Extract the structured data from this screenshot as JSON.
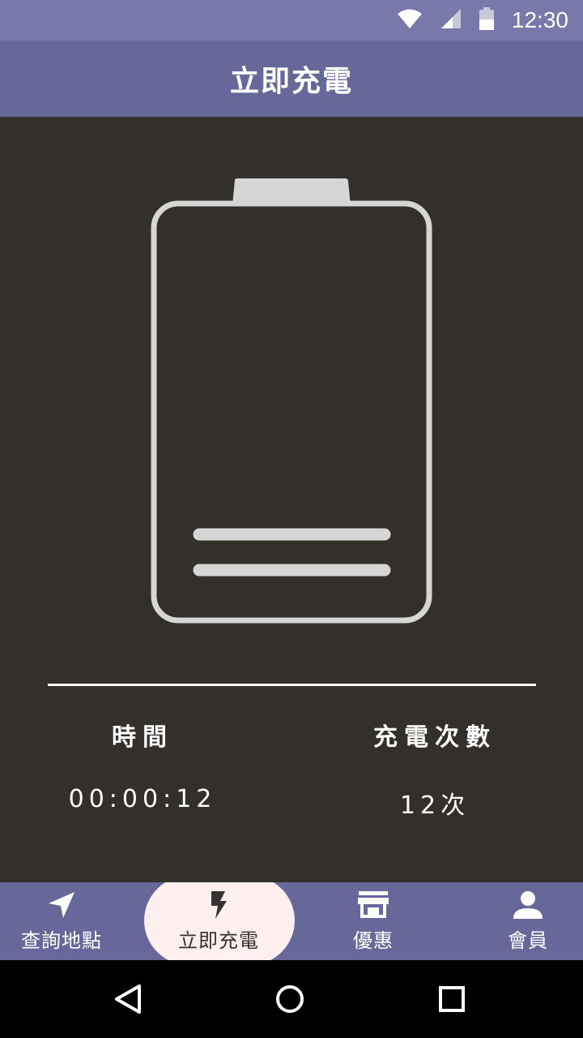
{
  "status_bar": {
    "time": "12:30",
    "icons": [
      "wifi-icon",
      "signal-icon",
      "battery-icon"
    ]
  },
  "app_bar": {
    "title": "立即充電"
  },
  "charging": {
    "battery_icon": "battery-outline-icon",
    "stats": [
      {
        "label": "時間",
        "value": "00:00:12"
      },
      {
        "label": "充電次數",
        "value": "12次"
      }
    ]
  },
  "bottom_nav": {
    "items": [
      {
        "label": "查詢地點",
        "icon": "navigation-arrow-icon"
      },
      {
        "label": "立即充電",
        "icon": "lightning-bolt-icon"
      },
      {
        "label": "優惠",
        "icon": "store-icon"
      },
      {
        "label": "會員",
        "icon": "person-icon"
      }
    ],
    "active_index": 1
  },
  "colors": {
    "status_bar": "#7878ab",
    "app_bar": "#67679a",
    "content_bg": "#332f2b",
    "active_tab_bg": "#fdf0ee"
  }
}
